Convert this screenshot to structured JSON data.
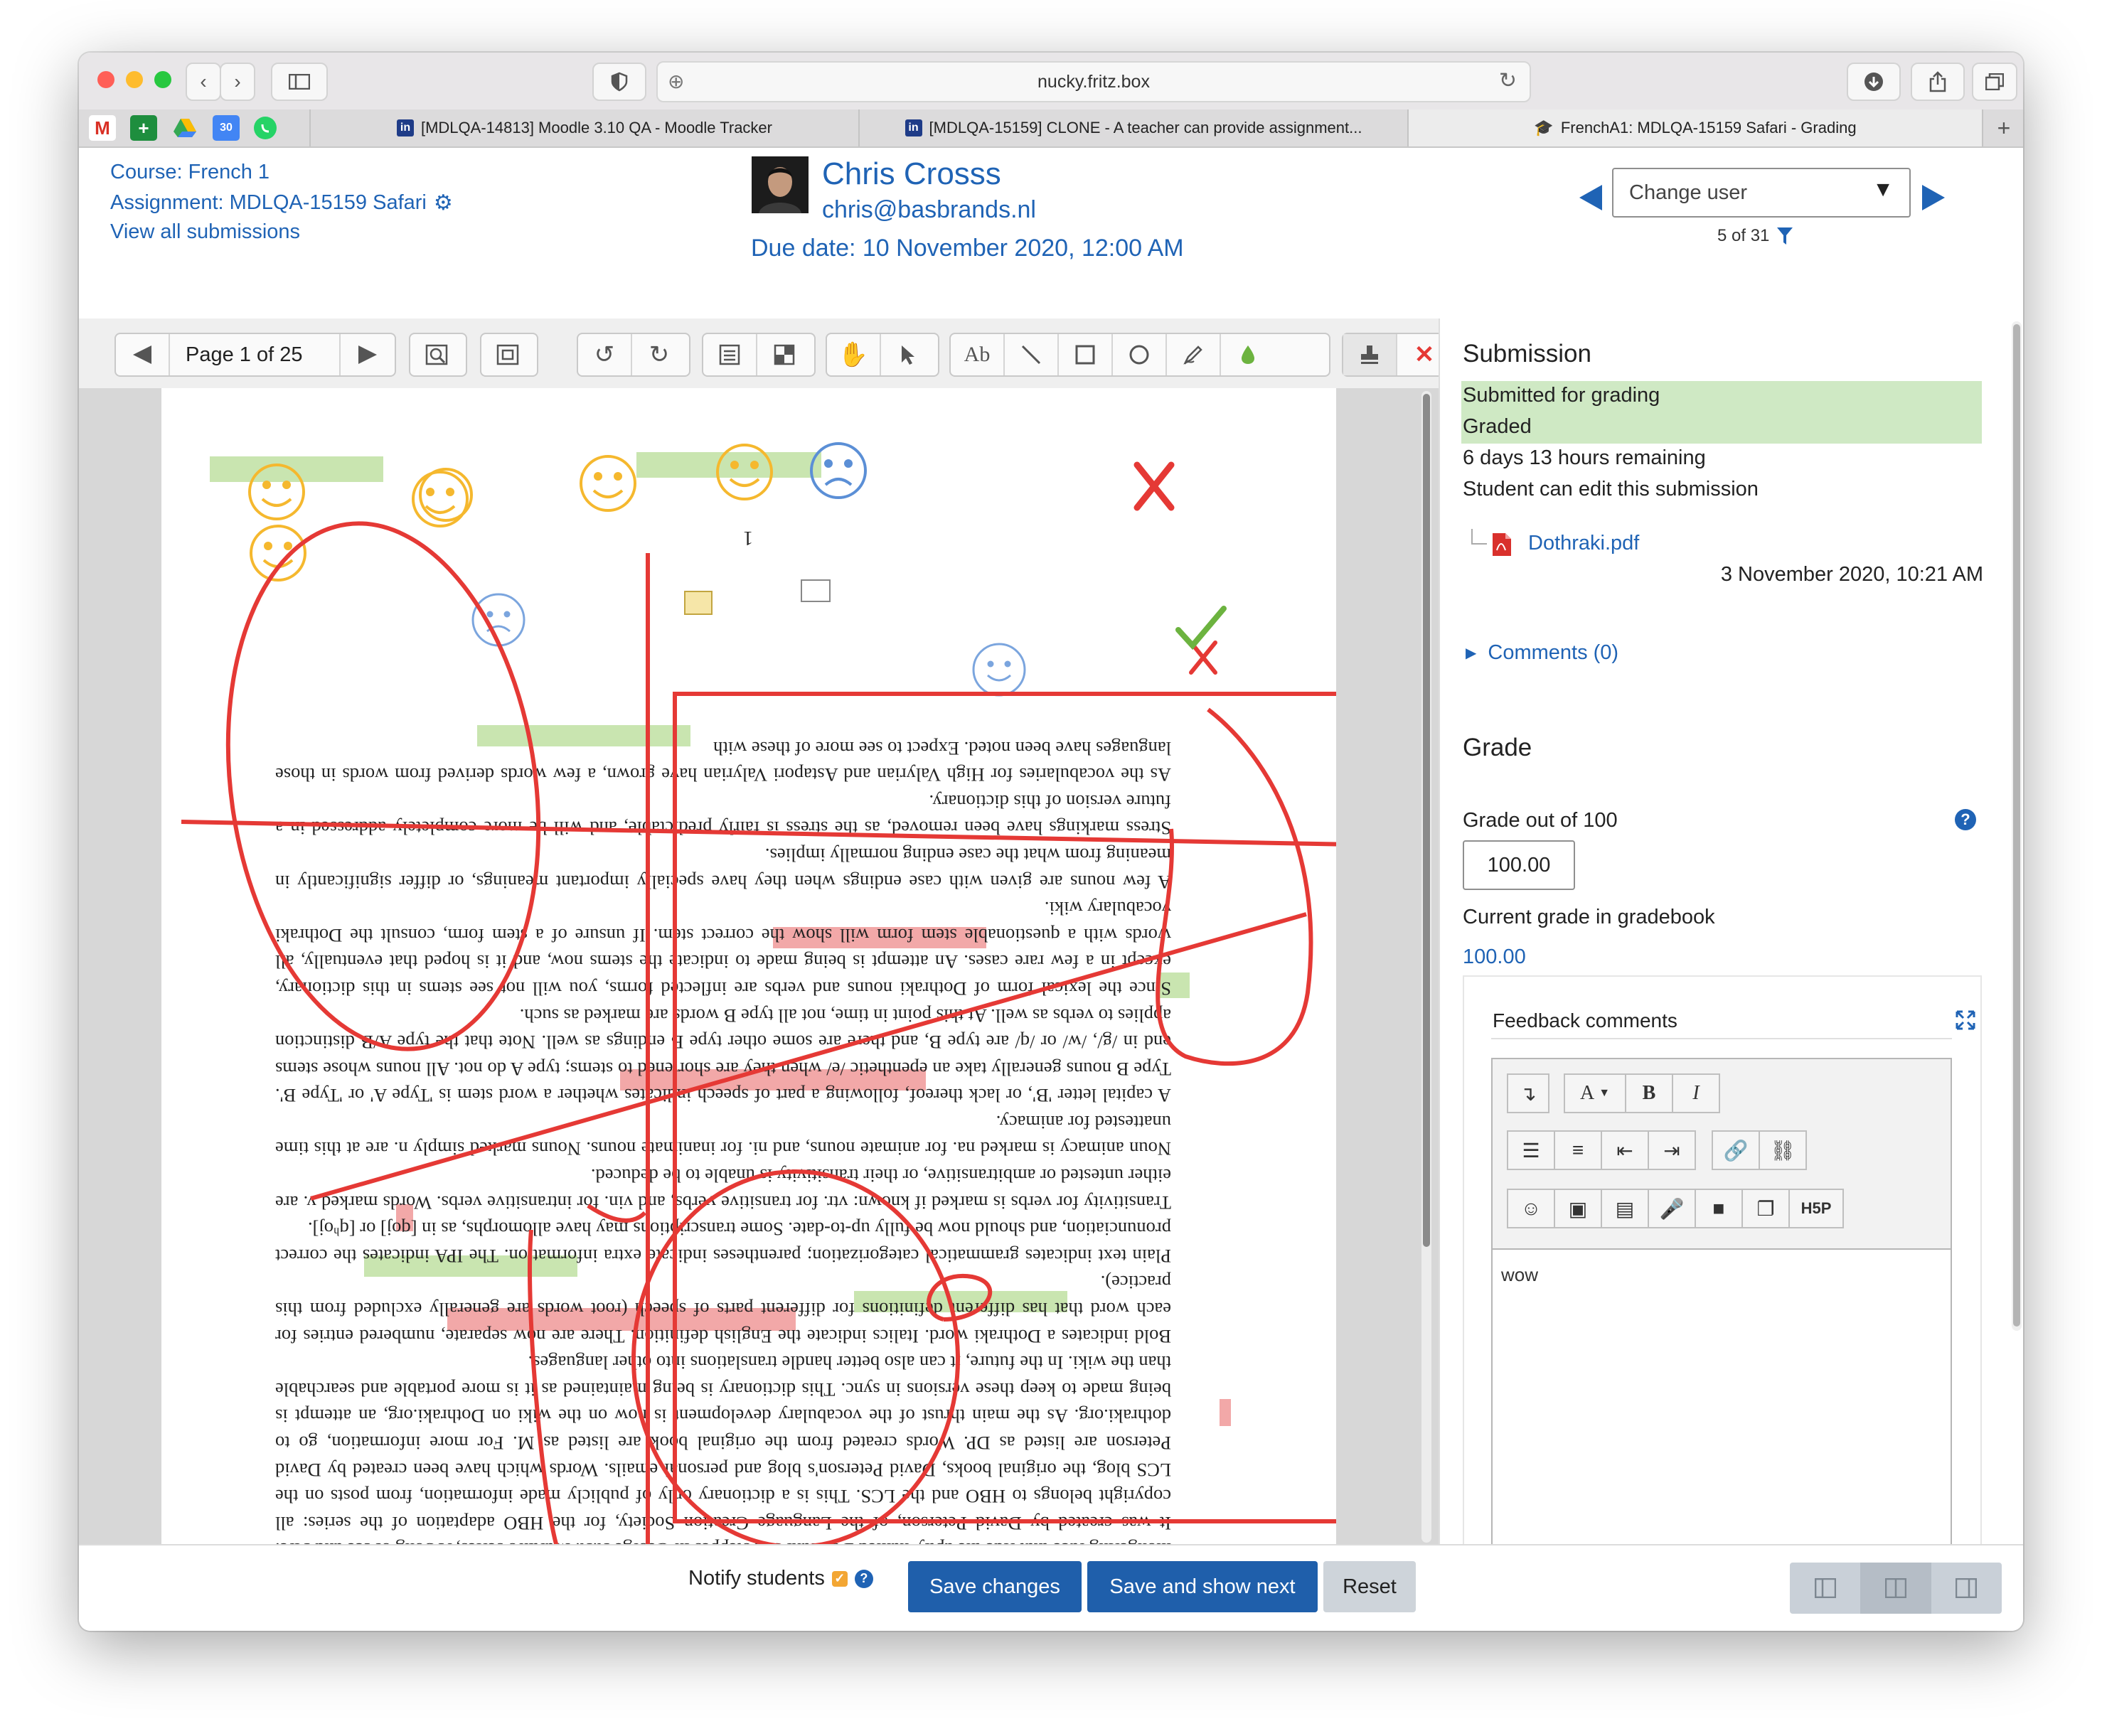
{
  "browser": {
    "url": "nucky.fritz.box",
    "tabs": [
      {
        "label": "[MDLQA-14813] Moodle 3.10 QA - Moodle Tracker",
        "favicon": "jira-icon"
      },
      {
        "label": "[MDLQA-15159] CLONE - A teacher can provide assignment...",
        "favicon": "jira-icon"
      },
      {
        "label": "FrenchA1: MDLQA-15159 Safari - Grading",
        "favicon": "moodle-icon"
      }
    ],
    "add_tab": "+"
  },
  "header": {
    "course_label": "Course: French 1",
    "assignment_label": "Assignment: MDLQA-15159 Safari",
    "view_all": "View all submissions",
    "user_name": "Chris Crosss",
    "user_email": "chris@basbrands.nl",
    "due_date": "Due date: 10 November 2020, 12:00 AM",
    "change_user": "Change user",
    "user_position": "5 of 31"
  },
  "pdf_toolbar": {
    "page_label": "Page 1 of 25"
  },
  "document": {
    "page_number": "1",
    "paragraphs": [
      "This is the first available Dothraki dictionary. Dothraki is the language for the Dothraki people, a nomadic war-mongering race that ride the aptly-named Dothraki Sea steppes in George R.R. Martin's series, A Song of Ice and Fire. It was created by David Peterson, of the Language Creation Society, for the HBO adaptation of the series: all copyright belongs to HBO and the LCS. This is a dictionary only of publicly made information, from posts on the LCS blog, the original books, David Peterson's blog and personal emails. Words which have been created by David Peterson are listed as DP. Words created from the original book are listed as M. For more information, go to dothraki.org. As the main thrust of the vocabulary development is now on the wiki on Dothraki.org, an attempt is being made to keep these versions in sync. This dictionary is being maintained as it is more portable and searchable than the wiki. In the future, it can also better handle translations into other languages.",
      "Bold indicates a Dothraki word. Italics indicate the English definition. There are now separate, numbered entries for each word that has different definitions for different parts of speech (root words are generally excluded from this practice).",
      "Plain text indicates grammatical categorization; parentheses indicate extra information. The IPA indicates the correct pronunciation, and should now be fully up-to-date. Some transcriptions may have allomorphs, as in [qoj] or [qʰoj].",
      "Transitivity for verbs is marked if known: vtr. for transitive verbs, and vin. for intransitive verbs. Words marked v. are either untested or ambitransitive, or their transitivity is unable to be deduced.",
      "Noun animacy is marked na. for animate nouns, and ni. for inanimate nouns. Nouns marked simply n. are at this time unattested for animacy.",
      "A capital letter 'B', or lack thereof, following a part of speech indicates whether a word stem is 'Type A' or 'Type B'. Type B nouns generally take an epenthetic /e/ when they are shortened to stems; type A do not. All nouns whose stems end in /g/, /w/ or /q/ are type B, and there are some other type B endings as well. Note that the type A/B distinction applies to verbs as well. At this point in time, not all type B words are marked as such.",
      "Since the lexical form of Dothraki nouns and verbs are inflected forms, you will not see stems in this dictionary, except in a few rare cases. An attempt is being made to indicate the stems now, and it is hoped that eventually, all words with a questionable stem form will show the correct stem. If unsure of a stem form, consult the Dothraki vocabulary wiki.",
      "A few nouns are given with case endings when they have specially important meanings, or differ significantly in meaning from what the case ending normally implies.",
      "Stress markings have been removed, as the stress is fairly predictable, and will be more completely addressed in a future version of this dictionary.",
      "As the vocabularies for High Valyrian and Astapori Valyrian have grown, a few words derived from words in those languages have been noted. Expect to see more of these with"
    ]
  },
  "submission": {
    "heading": "Submission",
    "status1": "Submitted for grading",
    "status2": "Graded",
    "time_remaining": "6 days 13 hours remaining",
    "can_edit": "Student can edit this submission",
    "file_name": "Dothraki.pdf",
    "file_date": "3 November 2020, 10:21 AM",
    "comments": "Comments (0)"
  },
  "grade": {
    "heading": "Grade",
    "out_of_label": "Grade out of 100",
    "value": "100.00",
    "gradebook_label": "Current grade in gradebook",
    "gradebook_value": "100.00",
    "feedback_label": "Feedback comments",
    "feedback_text": "wow",
    "editor_font_button": "A",
    "editor_bold": "B",
    "editor_italic": "I",
    "editor_h5p": "H5P"
  },
  "footer": {
    "notify_label": "Notify students",
    "save_changes": "Save changes",
    "save_next": "Save and show next",
    "reset": "Reset"
  },
  "colors": {
    "moodle_blue": "#1f63b5",
    "primary_button": "#1f5fab",
    "status_green": "#cfe9c4",
    "annotation_red": "#e53935",
    "highlight_green": "#b7dc9a",
    "highlight_red": "#f2a0a0",
    "smiley_yellow": "#f5b82e",
    "frown_blue": "#5b8fd6"
  }
}
